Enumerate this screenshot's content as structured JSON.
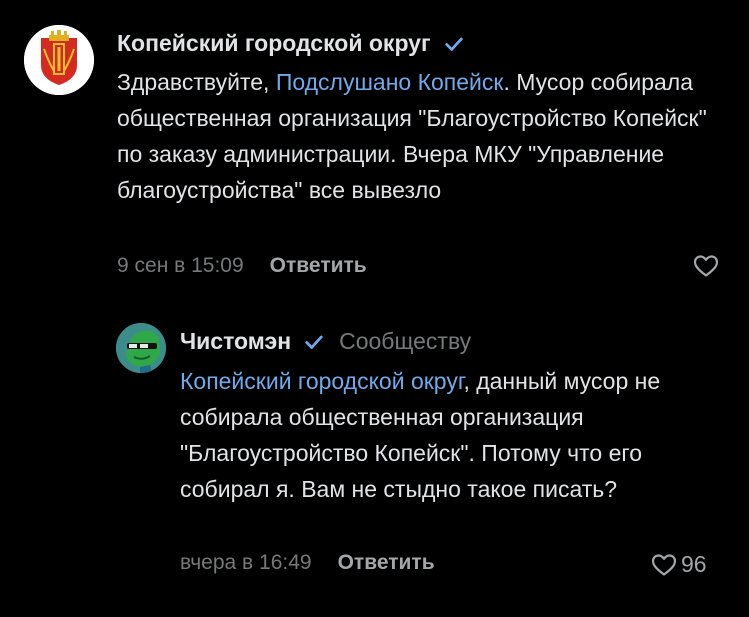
{
  "comments": [
    {
      "author": "Копейский городской округ",
      "verified": true,
      "mention": "Подслушано Копейск",
      "text_before": "Здравствуйте, ",
      "text_after": ". Мусор собирала общественная организация \"Благоустройство Копейск\" по заказу администрации. Вчера МКУ \"Управление благоустройства\" все вывезло",
      "time": "9 сен в 15:09",
      "reply_label": "Ответить",
      "likes": ""
    },
    {
      "author": "Чистомэн",
      "verified": true,
      "to_label": "Сообществу",
      "mention": "Копейский городской округ",
      "text_after": ", данный мусор не собирала общественная организация \"Благоустройство Копейск\". Потому что его собирал я. Вам не стыдно такое писать?",
      "time": "вчера в 16:49",
      "reply_label": "Ответить",
      "likes": "96"
    }
  ],
  "colors": {
    "background": "#000000",
    "text": "#e1e3e6",
    "link": "#71aaeb",
    "secondary": "#76787a",
    "verified": "#71aaeb"
  }
}
